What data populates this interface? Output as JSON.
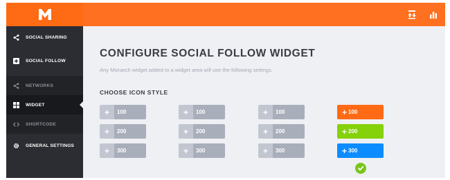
{
  "header": {
    "logo_letter": "M",
    "icons": [
      "share-counts-icon",
      "stats-icon"
    ]
  },
  "sidebar": {
    "items": [
      {
        "label": "Social Sharing",
        "icon": "share-icon",
        "kind": "primary"
      },
      {
        "label": "Social Follow",
        "icon": "plus-square-icon",
        "kind": "primary"
      },
      {
        "label": "Networks",
        "icon": "share-icon",
        "kind": "secondary"
      },
      {
        "label": "Widget",
        "icon": "grid-icon",
        "kind": "secondary",
        "active": true
      },
      {
        "label": "Shortcode",
        "icon": "code-icon",
        "kind": "secondary"
      },
      {
        "label": "General Settings",
        "icon": "gear-icon",
        "kind": "primary"
      }
    ]
  },
  "main": {
    "title": "CONFIGURE SOCIAL FOLLOW WIDGET",
    "subtitle": "Any Monarch widget added to a widget area will use the following settings.",
    "section_label": "CHOOSE ICON STYLE",
    "icon_styles": [
      {
        "style": "gray",
        "selected": false,
        "buttons": [
          {
            "plus": "+",
            "count": "100"
          },
          {
            "plus": "+",
            "count": "200"
          },
          {
            "plus": "+",
            "count": "300"
          }
        ]
      },
      {
        "style": "gray",
        "selected": false,
        "buttons": [
          {
            "plus": "+",
            "count": "100"
          },
          {
            "plus": "+",
            "count": "200"
          },
          {
            "plus": "+",
            "count": "300"
          }
        ]
      },
      {
        "style": "gray",
        "selected": false,
        "buttons": [
          {
            "plus": "+",
            "count": "100"
          },
          {
            "plus": "+",
            "count": "200"
          },
          {
            "plus": "+",
            "count": "300"
          }
        ]
      },
      {
        "style": "colored",
        "selected": true,
        "buttons": [
          {
            "plus": "+",
            "count": "100"
          },
          {
            "plus": "+",
            "count": "200"
          },
          {
            "plus": "+",
            "count": "300"
          }
        ]
      }
    ]
  },
  "colors": {
    "brand_orange": "#ff7020",
    "sidebar_bg": "#2c2d33",
    "button_orange": "#ff6a14",
    "button_green": "#85d10a",
    "button_blue": "#0d8cff",
    "check_green": "#79c61a"
  }
}
